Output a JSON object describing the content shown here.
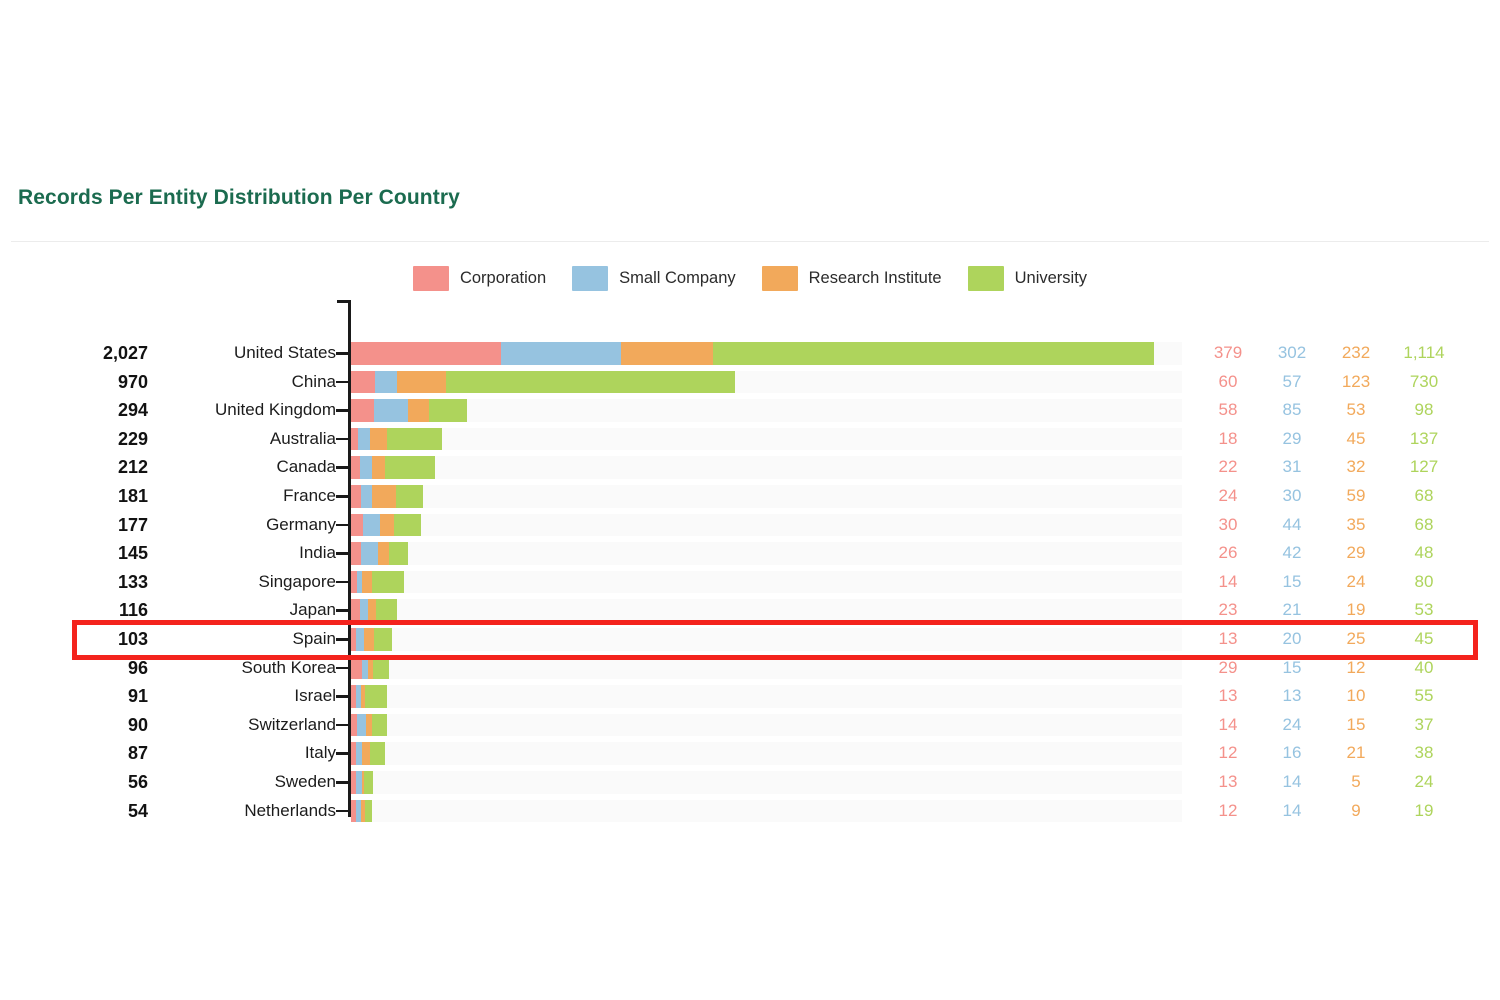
{
  "title": "Records Per Entity Distribution Per Country",
  "colors": {
    "corporation": "#f4918b",
    "small_company": "#96c3e0",
    "research_institute": "#f2a95b",
    "university": "#aed45c",
    "title": "#1b6b4f",
    "highlight": "#f4231d",
    "track": "#fafafa",
    "axis": "#1a1a1a"
  },
  "legend": {
    "items": [
      {
        "label": "Corporation",
        "color": "#f4918b"
      },
      {
        "label": "Small Company",
        "color": "#96c3e0"
      },
      {
        "label": "Research Institute",
        "color": "#f2a95b"
      },
      {
        "label": "University",
        "color": "#aed45c"
      }
    ]
  },
  "highlight": {
    "row": "Spain",
    "index": 10
  },
  "chart_data": {
    "type": "bar",
    "subtype": "horizontal-stacked",
    "title": "Records Per Entity Distribution Per Country",
    "xlabel": "",
    "ylabel": "",
    "grid": false,
    "legend_position": "top-center",
    "xlim": [
      0,
      2027
    ],
    "categories": [
      "United States",
      "China",
      "United Kingdom",
      "Australia",
      "Canada",
      "France",
      "Germany",
      "India",
      "Singapore",
      "Japan",
      "Spain",
      "South Korea",
      "Israel",
      "Switzerland",
      "Italy",
      "Sweden",
      "Netherlands"
    ],
    "series": [
      {
        "name": "Corporation",
        "color": "#f4918b",
        "values": [
          379,
          60,
          58,
          18,
          22,
          24,
          30,
          26,
          14,
          23,
          13,
          29,
          13,
          14,
          12,
          13,
          12
        ]
      },
      {
        "name": "Small Company",
        "color": "#96c3e0",
        "values": [
          302,
          57,
          85,
          29,
          31,
          30,
          44,
          42,
          15,
          21,
          20,
          15,
          13,
          24,
          16,
          14,
          14
        ]
      },
      {
        "name": "Research Institute",
        "color": "#f2a95b",
        "values": [
          232,
          123,
          53,
          45,
          32,
          59,
          35,
          29,
          24,
          19,
          25,
          12,
          10,
          15,
          21,
          5,
          9
        ]
      },
      {
        "name": "University",
        "color": "#aed45c",
        "values": [
          1114,
          730,
          98,
          137,
          127,
          68,
          68,
          48,
          80,
          53,
          45,
          40,
          55,
          37,
          38,
          24,
          19
        ]
      }
    ],
    "totals": [
      2027,
      970,
      294,
      229,
      212,
      181,
      177,
      145,
      133,
      116,
      103,
      96,
      91,
      90,
      87,
      56,
      54
    ],
    "totals_display": [
      "2,027",
      "970",
      "294",
      "229",
      "212",
      "181",
      "177",
      "145",
      "133",
      "116",
      "103",
      "96",
      "91",
      "90",
      "87",
      "56",
      "54"
    ],
    "value_labels": [
      [
        "379",
        "302",
        "232",
        "1,114"
      ],
      [
        "60",
        "57",
        "123",
        "730"
      ],
      [
        "58",
        "85",
        "53",
        "98"
      ],
      [
        "18",
        "29",
        "45",
        "137"
      ],
      [
        "22",
        "31",
        "32",
        "127"
      ],
      [
        "24",
        "30",
        "59",
        "68"
      ],
      [
        "30",
        "44",
        "35",
        "68"
      ],
      [
        "26",
        "42",
        "29",
        "48"
      ],
      [
        "14",
        "15",
        "24",
        "80"
      ],
      [
        "23",
        "21",
        "19",
        "53"
      ],
      [
        "13",
        "20",
        "25",
        "45"
      ],
      [
        "29",
        "15",
        "12",
        "40"
      ],
      [
        "13",
        "13",
        "10",
        "55"
      ],
      [
        "14",
        "24",
        "15",
        "37"
      ],
      [
        "12",
        "16",
        "21",
        "38"
      ],
      [
        "13",
        "14",
        "5",
        "24"
      ],
      [
        "12",
        "14",
        "9",
        "19"
      ]
    ]
  }
}
